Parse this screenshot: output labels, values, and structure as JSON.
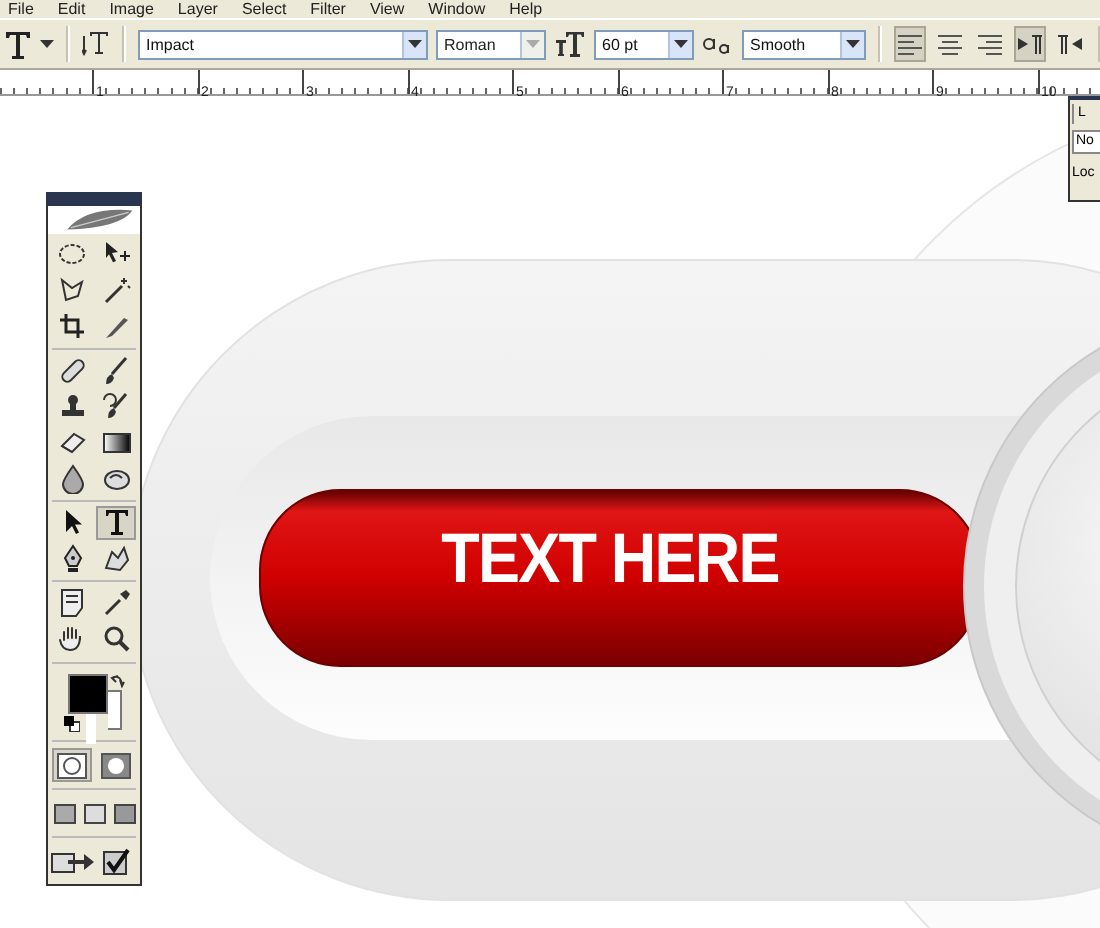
{
  "menu": [
    "File",
    "Edit",
    "Image",
    "Layer",
    "Select",
    "Filter",
    "View",
    "Window",
    "Help"
  ],
  "options": {
    "font_family": "Impact",
    "font_style": "Roman",
    "font_size": "60 pt",
    "antialias": "Smooth",
    "align": [
      {
        "selected": true
      },
      {
        "selected": false
      },
      {
        "selected": false
      }
    ],
    "direction": [
      {
        "selected": true
      },
      {
        "selected": false
      }
    ]
  },
  "ruler": [
    "1",
    "2",
    "3",
    "4",
    "5",
    "6",
    "7",
    "8",
    "9",
    "10"
  ],
  "toolbox": {
    "tools": [
      {
        "kind": "marquee",
        "selected": false
      },
      {
        "kind": "move",
        "selected": false
      },
      {
        "kind": "lasso",
        "selected": false
      },
      {
        "kind": "wand",
        "selected": false
      },
      {
        "kind": "crop",
        "selected": false
      },
      {
        "kind": "slice",
        "selected": false
      },
      {
        "kind": "heal",
        "selected": false
      },
      {
        "kind": "brush",
        "selected": false
      },
      {
        "kind": "stamp",
        "selected": false
      },
      {
        "kind": "history",
        "selected": false
      },
      {
        "kind": "eraser",
        "selected": false
      },
      {
        "kind": "gradient",
        "selected": false
      },
      {
        "kind": "blur",
        "selected": false
      },
      {
        "kind": "dodge",
        "selected": false
      },
      {
        "kind": "select",
        "selected": false
      },
      {
        "kind": "type",
        "selected": true
      },
      {
        "kind": "pen",
        "selected": false
      },
      {
        "kind": "shape",
        "selected": false
      },
      {
        "kind": "notes",
        "selected": false
      },
      {
        "kind": "eyedropper",
        "selected": false
      },
      {
        "kind": "hand",
        "selected": false
      },
      {
        "kind": "zoom",
        "selected": false
      }
    ]
  },
  "canvas": {
    "headline": "TEXT HERE"
  },
  "layers_panel": {
    "tab": "L",
    "blend_mode": "No",
    "lock_label": "Loc"
  }
}
